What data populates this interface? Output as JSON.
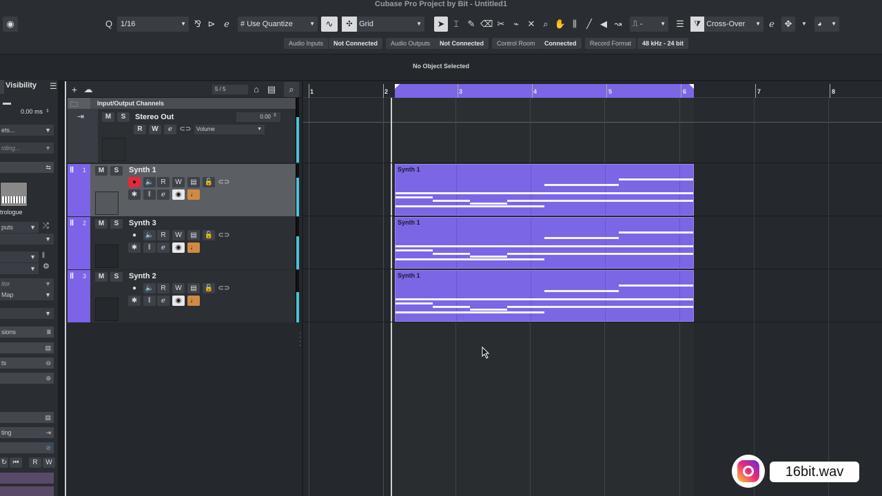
{
  "window": {
    "title": "Cubase Pro Project by Bit - Untitled1"
  },
  "toolbar": {
    "quantize_value": "1/16",
    "use_quantize": "Use Quantize",
    "snap_type": "Grid",
    "dash": "-",
    "crossfade_mode": "Cross-Over"
  },
  "status": {
    "audio_inputs_label": "Audio Inputs",
    "audio_inputs_value": "Not Connected",
    "audio_outputs_label": "Audio Outputs",
    "audio_outputs_value": "Not Connected",
    "control_room_label": "Control Room",
    "control_room_value": "Connected",
    "record_format_label": "Record Format",
    "record_format_value": "48 kHz - 24 bit"
  },
  "infoline": {
    "text": "No Object Selected"
  },
  "inspector": {
    "visibility_tab": "Visibility",
    "delay_value": "0.00 ms",
    "presets": "ets...",
    "recording": "rding...",
    "instrument_name": "trologue",
    "outputs": "puts",
    "editor": "itor",
    "map": "Map",
    "sections": [
      "sions",
      "ts",
      "ting"
    ],
    "r_label": "R",
    "w_label": "W"
  },
  "tracklist": {
    "count": "5 / 5",
    "folder_name": "Input/Output Channels",
    "stereo_out": {
      "name": "Stereo Out",
      "value": "0.00",
      "automation": "Volume",
      "mute": "M",
      "solo": "S",
      "read": "R",
      "write": "W"
    },
    "tracks": [
      {
        "number": "1",
        "name": "Synth 1",
        "mute": "M",
        "solo": "S",
        "read": "R",
        "write": "W"
      },
      {
        "number": "2",
        "name": "Synth 3",
        "mute": "M",
        "solo": "S",
        "read": "R",
        "write": "W"
      },
      {
        "number": "3",
        "name": "Synth 2",
        "mute": "M",
        "solo": "S",
        "read": "R",
        "write": "W"
      }
    ]
  },
  "ruler": {
    "bars": [
      "1",
      "2",
      "3",
      "4",
      "5",
      "6",
      "7",
      "8"
    ]
  },
  "parts": [
    {
      "name": "Synth 1"
    },
    {
      "name": "Synth 1"
    },
    {
      "name": "Synth 1"
    }
  ],
  "watermark": {
    "handle": "16bit.wav"
  },
  "colors": {
    "track": "#7c63e8",
    "part": "#7b66e6",
    "record": "#e5283a",
    "meter": "#4fc3d8"
  }
}
